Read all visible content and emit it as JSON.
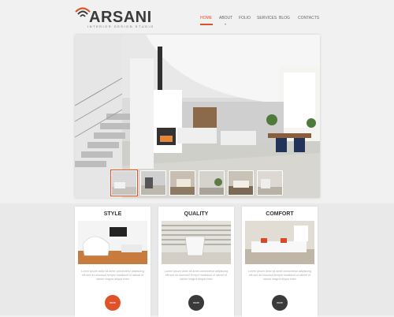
{
  "brand": {
    "name": "ARSANI",
    "tagline": "INTERIOR DESIGN STUDIO",
    "accent_color": "#e0532a"
  },
  "nav": {
    "items": [
      {
        "label": "HOME",
        "active": true
      },
      {
        "label": "ABOUT",
        "active": false
      },
      {
        "label": "FOLIO",
        "active": false
      },
      {
        "label": "SERVICES",
        "active": false
      },
      {
        "label": "BLOG",
        "active": false
      },
      {
        "label": "CONTACTS",
        "active": false
      }
    ]
  },
  "hero": {
    "thumbnail_count": 6,
    "active_thumbnail": 1
  },
  "features": [
    {
      "title": "STYLE",
      "text": "Lorem ipsum dolor sit amet consectetur adipiscing elit sed do eiusmod tempor incididunt ut labore et dolore magna aliqua enim",
      "button": "more",
      "button_color": "#e0532a"
    },
    {
      "title": "QUALITY",
      "text": "Lorem ipsum dolor sit amet consectetur adipiscing elit sed do eiusmod tempor incididunt ut labore et dolore magna aliqua enim",
      "button": "more",
      "button_color": "#3a3a3a"
    },
    {
      "title": "COMFORT",
      "text": "Lorem ipsum dolor sit amet consectetur adipiscing elit sed do eiusmod tempor incididunt ut labore et dolore magna aliqua enim",
      "button": "more",
      "button_color": "#3a3a3a"
    }
  ]
}
